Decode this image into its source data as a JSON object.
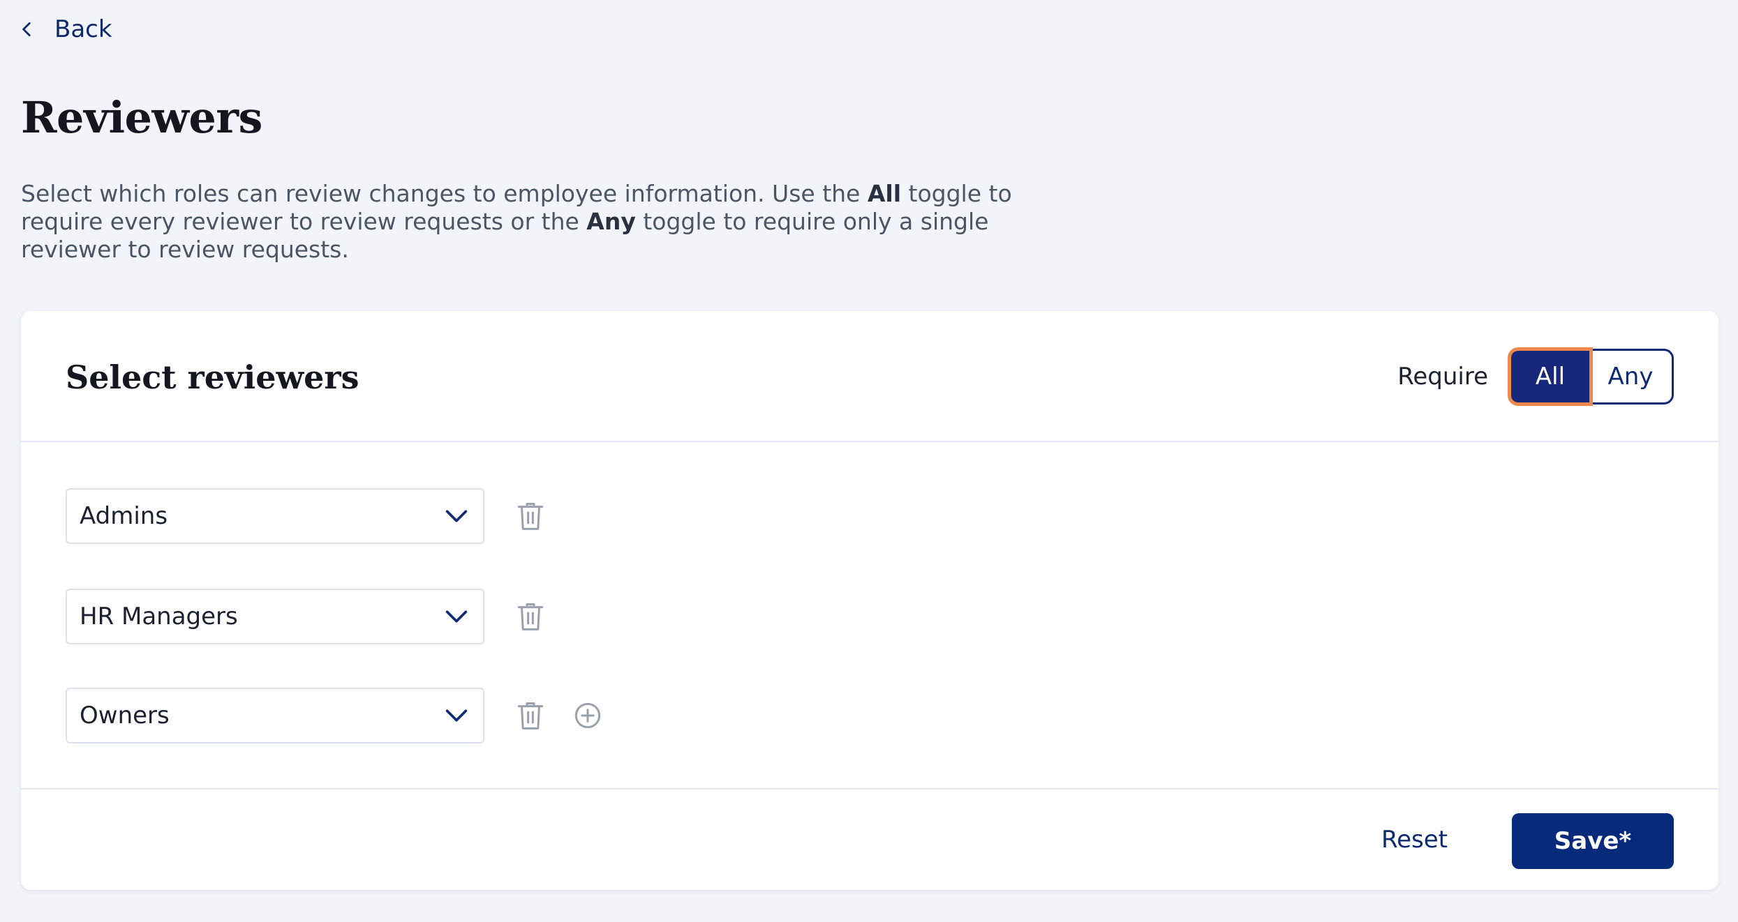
{
  "nav": {
    "back_label": "Back",
    "back_icon": "chevron-left-icon"
  },
  "page": {
    "title": "Reviewers",
    "description": {
      "part1": "Select which roles can review changes to employee information. Use the ",
      "bold1": "All",
      "part2": " toggle to require every reviewer to review requests or the ",
      "bold2": "Any",
      "part3": " toggle to require only a single reviewer to review requests."
    }
  },
  "card": {
    "title": "Select reviewers",
    "require_label": "Require",
    "toggle": {
      "options": [
        "All",
        "Any"
      ],
      "selected": "All"
    },
    "reviewers": [
      {
        "value": "Admins"
      },
      {
        "value": "HR Managers"
      },
      {
        "value": "Owners"
      }
    ],
    "icons": {
      "dropdown": "chevron-down-icon",
      "delete": "trash-icon",
      "add": "plus-circle-icon"
    }
  },
  "footer": {
    "reset_label": "Reset",
    "save_label": "Save*"
  },
  "colors": {
    "background": "#f1f4f9",
    "primary": "#082a7a",
    "toggle_active": "#17287a",
    "focus_ring": "#ef8a4c",
    "muted_icon": "#9aa1ad"
  }
}
